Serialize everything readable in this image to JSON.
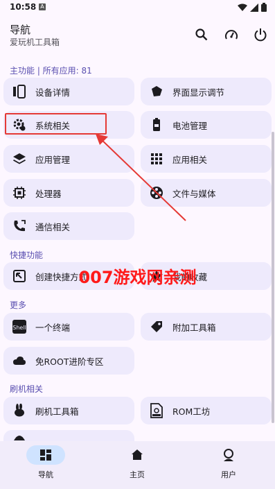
{
  "status": {
    "time": "10:58",
    "a_badge": "A"
  },
  "header": {
    "title": "导航",
    "subtitle": "爱玩机工具箱"
  },
  "sections": {
    "main": "主功能 | 所有应用: 81",
    "shortcut": "快捷功能",
    "more": "更多",
    "flash": "刷机相关"
  },
  "cards": {
    "device_info": "设备详情",
    "display_tuning": "界面显示调节",
    "system": "系统相关",
    "battery": "电池管理",
    "app_manage": "应用管理",
    "app_related": "应用相关",
    "processor": "处理器",
    "files_media": "文件与媒体",
    "communication": "通信相关",
    "create_shortcut": "创建快捷方式",
    "my_collection": "我的收藏",
    "terminal": "一个终端",
    "addon_tools": "附加工具箱",
    "no_root": "免ROOT进阶专区",
    "flash_toolbox": "刷机工具箱",
    "rom_workshop": "ROM工坊"
  },
  "watermark": "007游戏网亲测",
  "nav": {
    "nav": "导航",
    "home": "主页",
    "user": "用户"
  },
  "colors": {
    "accent": "#5a4fb0",
    "card": "#eeeafc",
    "highlight": "#e53935"
  }
}
